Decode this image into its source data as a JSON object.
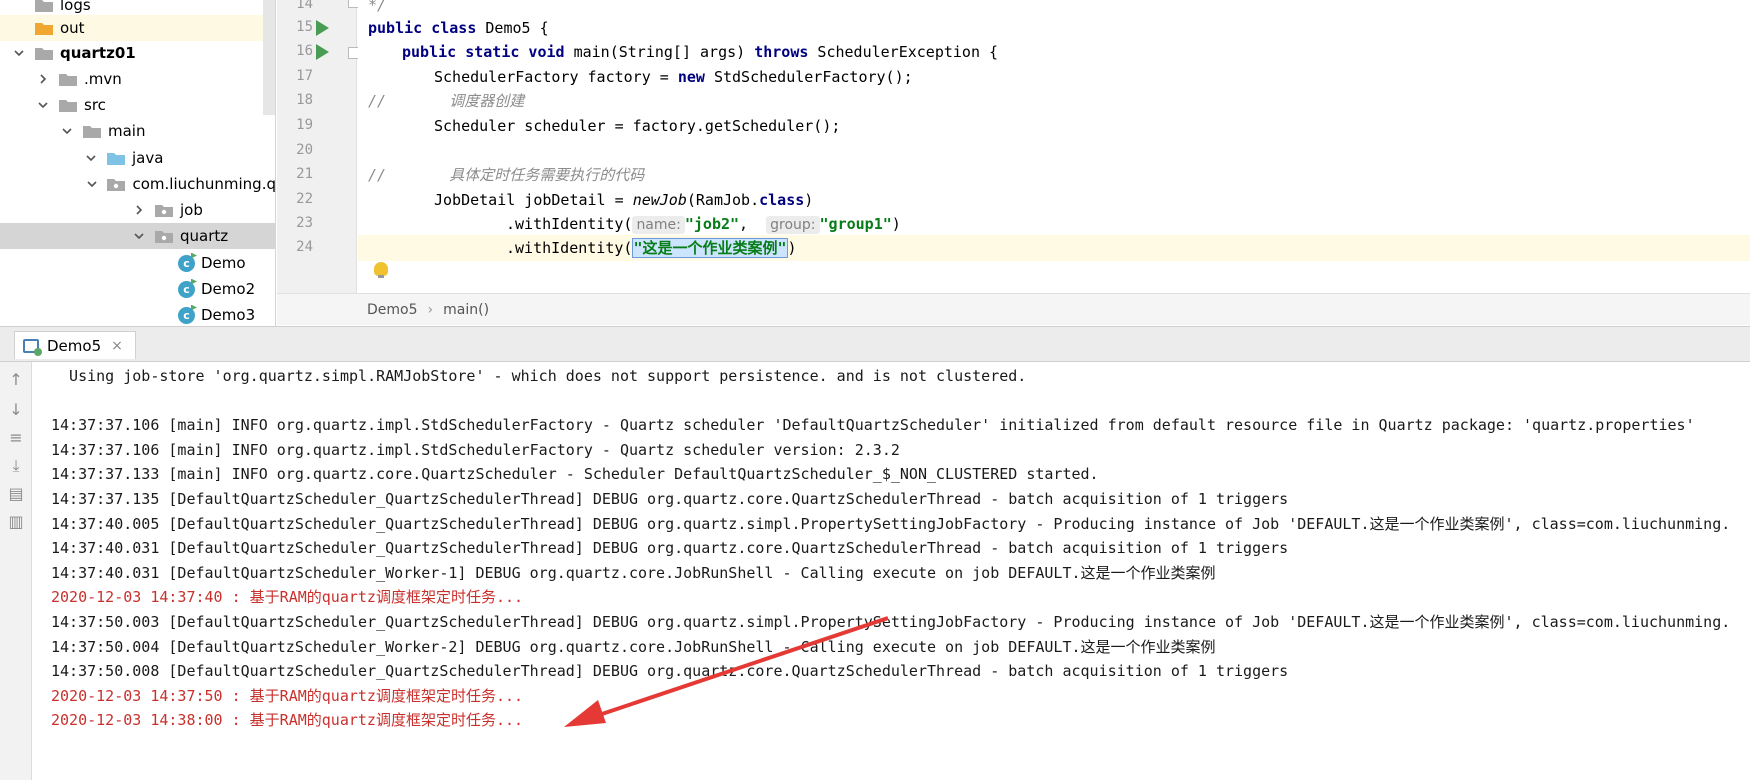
{
  "tree": {
    "items": [
      {
        "label": "logs",
        "depth": 0,
        "arrow": "",
        "icon": "folder-gray",
        "state": ""
      },
      {
        "label": "out",
        "depth": 0,
        "arrow": "",
        "icon": "folder-orange",
        "state": "light"
      },
      {
        "label": "quartz01",
        "depth": 0,
        "arrow": "down",
        "icon": "folder-gray",
        "state": "bold"
      },
      {
        "label": ".mvn",
        "depth": 1,
        "arrow": "right",
        "icon": "folder-gray",
        "state": ""
      },
      {
        "label": "src",
        "depth": 1,
        "arrow": "down",
        "icon": "folder-gray",
        "state": ""
      },
      {
        "label": "main",
        "depth": 2,
        "arrow": "down",
        "icon": "folder-gray",
        "state": ""
      },
      {
        "label": "java",
        "depth": 3,
        "arrow": "down",
        "icon": "folder-blue",
        "state": ""
      },
      {
        "label": "com.liuchunming.q",
        "depth": 4,
        "arrow": "down",
        "icon": "package",
        "state": ""
      },
      {
        "label": "job",
        "depth": 5,
        "arrow": "right",
        "icon": "package",
        "state": ""
      },
      {
        "label": "quartz",
        "depth": 5,
        "arrow": "down",
        "icon": "package",
        "state": "selected"
      },
      {
        "label": "Demo",
        "depth": 6,
        "arrow": "",
        "icon": "class",
        "state": ""
      },
      {
        "label": "Demo2",
        "depth": 6,
        "arrow": "",
        "icon": "class",
        "state": ""
      },
      {
        "label": "Demo3",
        "depth": 6,
        "arrow": "",
        "icon": "class",
        "state": ""
      }
    ]
  },
  "editor": {
    "line_numbers": [
      "14",
      "15",
      "16",
      "17",
      "18",
      "19",
      "20",
      "21",
      "22",
      "23",
      "24"
    ],
    "code": {
      "l14": "*/",
      "l15_kw": "public class",
      "l15_rest": " Demo5 {",
      "l16_kw1": "public static void",
      "l16_mid": " main(String[] args) ",
      "l16_kw2": "throws",
      "l16_rest": " SchedulerException {",
      "l17_a": "SchedulerFactory factory = ",
      "l17_kw": "new",
      "l17_b": " StdSchedulerFactory();",
      "l18": "//       调度器创建",
      "l19": "Scheduler scheduler = factory.getScheduler();",
      "l21": "//       具体定时任务需要执行的代码",
      "l22_a": "JobDetail jobDetail = ",
      "l22_i": "newJob",
      "l22_b": "(RamJob.",
      "l22_kw": "class",
      "l22_c": ")",
      "l23_a": ".withIdentity(",
      "l23_hint1": "name:",
      "l23_s1": "\"job2\"",
      "l23_comma": ",  ",
      "l23_hint2": "group:",
      "l23_s2": "\"group1\"",
      "l23_close": ")",
      "l24_a": ".withIdentity(",
      "l24_s": "\"这是一个作业类案例\"",
      "l24_close": ")"
    }
  },
  "breadcrumb": {
    "file": "Demo5",
    "method": "main()"
  },
  "run": {
    "tab_label": "Demo5",
    "close_glyph": "×",
    "logs": [
      {
        "text": "  Using job-store 'org.quartz.simpl.RAMJobStore' - which does not support persistence. and is not clustered.",
        "red": false
      },
      {
        "text": "",
        "red": false
      },
      {
        "text": "14:37:37.106 [main] INFO org.quartz.impl.StdSchedulerFactory - Quartz scheduler 'DefaultQuartzScheduler' initialized from default resource file in Quartz package: 'quartz.properties'",
        "red": false
      },
      {
        "text": "14:37:37.106 [main] INFO org.quartz.impl.StdSchedulerFactory - Quartz scheduler version: 2.3.2",
        "red": false
      },
      {
        "text": "14:37:37.133 [main] INFO org.quartz.core.QuartzScheduler - Scheduler DefaultQuartzScheduler_$_NON_CLUSTERED started.",
        "red": false
      },
      {
        "text": "14:37:37.135 [DefaultQuartzScheduler_QuartzSchedulerThread] DEBUG org.quartz.core.QuartzSchedulerThread - batch acquisition of 1 triggers",
        "red": false
      },
      {
        "text": "14:37:40.005 [DefaultQuartzScheduler_QuartzSchedulerThread] DEBUG org.quartz.simpl.PropertySettingJobFactory - Producing instance of Job 'DEFAULT.这是一个作业类案例', class=com.liuchunming.",
        "red": false
      },
      {
        "text": "14:37:40.031 [DefaultQuartzScheduler_QuartzSchedulerThread] DEBUG org.quartz.core.QuartzSchedulerThread - batch acquisition of 1 triggers",
        "red": false
      },
      {
        "text": "14:37:40.031 [DefaultQuartzScheduler_Worker-1] DEBUG org.quartz.core.JobRunShell - Calling execute on job DEFAULT.这是一个作业类案例",
        "red": false
      },
      {
        "text": "2020-12-03 14:37:40 : 基于RAM的quartz调度框架定时任务...",
        "red": true
      },
      {
        "text": "14:37:50.003 [DefaultQuartzScheduler_QuartzSchedulerThread] DEBUG org.quartz.simpl.PropertySettingJobFactory - Producing instance of Job 'DEFAULT.这是一个作业类案例', class=com.liuchunming.",
        "red": false
      },
      {
        "text": "14:37:50.004 [DefaultQuartzScheduler_Worker-2] DEBUG org.quartz.core.JobRunShell - Calling execute on job DEFAULT.这是一个作业类案例",
        "red": false
      },
      {
        "text": "14:37:50.008 [DefaultQuartzScheduler_QuartzSchedulerThread] DEBUG org.quartz.core.QuartzSchedulerThread - batch acquisition of 1 triggers",
        "red": false
      },
      {
        "text": "2020-12-03 14:37:50 : 基于RAM的quartz调度框架定时任务...",
        "red": true
      },
      {
        "text": "2020-12-03 14:38:00 : 基于RAM的quartz调度框架定时任务...",
        "red": true
      }
    ]
  },
  "colors": {
    "keyword": "#000080",
    "string": "#067d17",
    "comment": "#8c8c8c",
    "console_stdout_red": "#c9302c",
    "annotation_arrow": "#e53935"
  }
}
